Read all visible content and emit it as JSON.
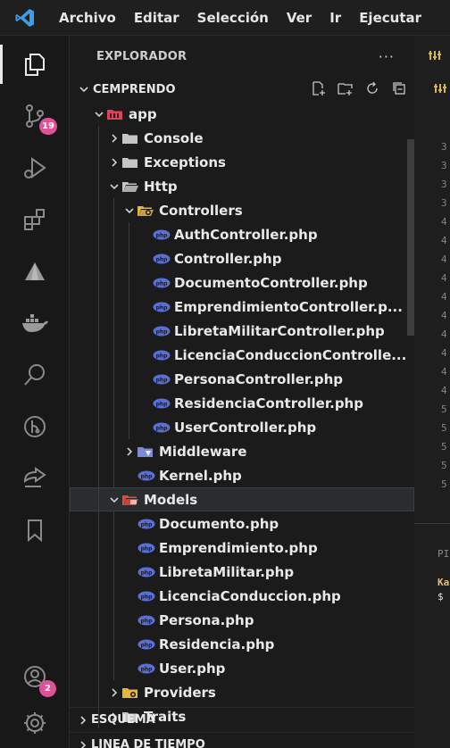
{
  "menu": [
    "Archivo",
    "Editar",
    "Selección",
    "Ver",
    "Ir",
    "Ejecutar"
  ],
  "activity": {
    "source_control_badge": "19",
    "accounts_badge": "2"
  },
  "sidebar": {
    "title": "EXPLORADOR",
    "more": "···",
    "project": "CEMPRENDO"
  },
  "tree": [
    {
      "label": "app",
      "type": "folder",
      "depth": 0,
      "open": true,
      "icon": "app"
    },
    {
      "label": "Console",
      "type": "folder",
      "depth": 1,
      "open": false,
      "icon": "plain"
    },
    {
      "label": "Exceptions",
      "type": "folder",
      "depth": 1,
      "open": false,
      "icon": "plain"
    },
    {
      "label": "Http",
      "type": "folder",
      "depth": 1,
      "open": true,
      "icon": "plain"
    },
    {
      "label": "Controllers",
      "type": "folder",
      "depth": 2,
      "open": true,
      "icon": "controllers"
    },
    {
      "label": "AuthController.php",
      "type": "file",
      "depth": 3
    },
    {
      "label": "Controller.php",
      "type": "file",
      "depth": 3
    },
    {
      "label": "DocumentoController.php",
      "type": "file",
      "depth": 3
    },
    {
      "label": "EmprendimientoController.p...",
      "type": "file",
      "depth": 3
    },
    {
      "label": "LibretaMilitarController.php",
      "type": "file",
      "depth": 3
    },
    {
      "label": "LicenciaConduccionControlle...",
      "type": "file",
      "depth": 3
    },
    {
      "label": "PersonaController.php",
      "type": "file",
      "depth": 3
    },
    {
      "label": "ResidenciaController.php",
      "type": "file",
      "depth": 3
    },
    {
      "label": "UserController.php",
      "type": "file",
      "depth": 3
    },
    {
      "label": "Middleware",
      "type": "folder",
      "depth": 2,
      "open": false,
      "icon": "middleware"
    },
    {
      "label": "Kernel.php",
      "type": "file",
      "depth": 2
    },
    {
      "label": "Models",
      "type": "folder",
      "depth": 1,
      "open": true,
      "icon": "models",
      "selected": true
    },
    {
      "label": "Documento.php",
      "type": "file",
      "depth": 2
    },
    {
      "label": "Emprendimiento.php",
      "type": "file",
      "depth": 2
    },
    {
      "label": "LibretaMilitar.php",
      "type": "file",
      "depth": 2
    },
    {
      "label": "LicenciaConduccion.php",
      "type": "file",
      "depth": 2
    },
    {
      "label": "Persona.php",
      "type": "file",
      "depth": 2
    },
    {
      "label": "Residencia.php",
      "type": "file",
      "depth": 2
    },
    {
      "label": "User.php",
      "type": "file",
      "depth": 2
    },
    {
      "label": "Providers",
      "type": "folder",
      "depth": 1,
      "open": false,
      "icon": "providers"
    },
    {
      "label": "Traits",
      "type": "folder",
      "depth": 1,
      "open": false,
      "icon": "plain"
    }
  ],
  "bottom_sections": [
    "ESQUEMA",
    "LÍNEA DE TIEMPO"
  ],
  "editor": {
    "line_numbers": [
      "3",
      "3",
      "3",
      "3",
      "4",
      "4",
      "4",
      "4",
      "4",
      "4",
      "4",
      "4",
      "4",
      "4",
      "5",
      "5",
      "5",
      "5",
      "5"
    ],
    "panel_label": "PI",
    "terminal_line1": "Ka",
    "terminal_line2": "$"
  },
  "colors": {
    "php_file_icon": "#5a6fd6",
    "folder_plain": "#c5c5c5",
    "folder_app": "#e0425a",
    "folder_controllers": "#e7b53d",
    "folder_models": "#e8473d",
    "folder_middleware": "#7b8cd6",
    "folder_providers": "#e7b53d",
    "vscode_blue": "#3b9ee8"
  }
}
